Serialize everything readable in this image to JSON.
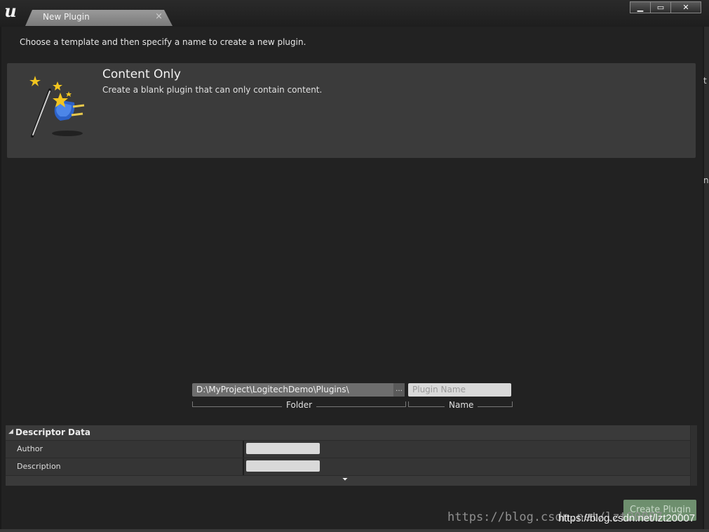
{
  "window": {
    "tab_title": "New Plugin",
    "tab_close": "×",
    "controls": {
      "minimize": "▁",
      "maximize": "▭",
      "close": "✕"
    }
  },
  "instructions": "Choose a template and then specify a name to create a new plugin.",
  "template": {
    "title": "Content Only",
    "description": "Create a blank plugin that can only contain content.",
    "icon": "magic-wand-plugin-icon"
  },
  "fields": {
    "folder_value": "D:\\MyProject\\LogitechDemo\\Plugins\\",
    "folder_browse": "…",
    "folder_label": "Folder",
    "name_placeholder": "Plugin Name",
    "name_label": "Name"
  },
  "descriptor": {
    "title": "Descriptor Data",
    "collapse_icon": "◢",
    "expand_icon": "⏷",
    "rows": [
      {
        "label": "Author",
        "value": ""
      },
      {
        "label": "Description",
        "value": ""
      }
    ]
  },
  "create_button": "Create Plugin",
  "watermark": {
    "text1": "https://blog.csdn.net/lzt20007",
    "text2": "https://blog.csdn.net/lzt20007"
  },
  "edge_glyphs": [
    "t",
    "n"
  ],
  "colors": {
    "background": "#1b1b1b",
    "panel": "#222222",
    "card": "#3b3b3b",
    "create_button": "#6e8f6e"
  }
}
